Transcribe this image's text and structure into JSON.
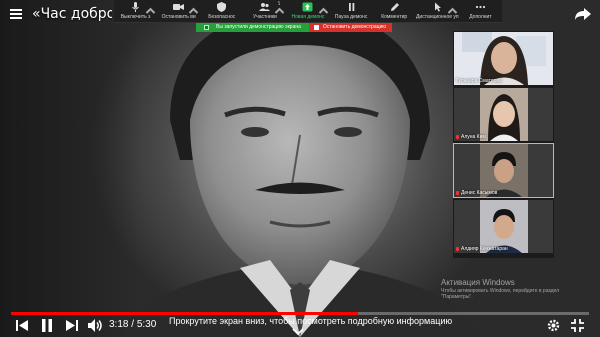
{
  "video": {
    "title": "«Час добропор",
    "current_time": "3:18",
    "separator": " / ",
    "duration": "5:30",
    "progress": 0.6,
    "hint": "Прокрутите экран вниз, чтобы посмотреть подробную информацию"
  },
  "zoom_toolbar": {
    "items": [
      {
        "label": "Выключить з",
        "icon": "microphone-icon"
      },
      {
        "label": "Остановить ви",
        "icon": "video-camera-icon"
      },
      {
        "label": "Безопаснос",
        "icon": "shield-icon"
      },
      {
        "label": "Участники",
        "icon": "participants-icon",
        "count": "5"
      },
      {
        "label": "Новая демонс",
        "icon": "share-screen-icon"
      },
      {
        "label": "Пауза демонс",
        "icon": "pause-icon"
      },
      {
        "label": "Комментир",
        "icon": "pencil-icon"
      },
      {
        "label": "Дистанционное уп",
        "icon": "remote-control-icon"
      },
      {
        "label": "Дополнит",
        "icon": "more-icon"
      }
    ]
  },
  "sharing_bar": {
    "status": "Вы запустили демонстрацию экрана",
    "stop_label": "Остановить демонстрацию"
  },
  "participants": [
    {
      "name": "Гульнара Сматлова",
      "muted": false
    },
    {
      "name": "Алуна Ким",
      "muted": true
    },
    {
      "name": "Денис Касымов",
      "muted": true
    },
    {
      "name": "Алдияр Кенжатаран",
      "muted": true
    }
  ],
  "watermark": {
    "line1": "Активация Windows",
    "line2": "Чтобы активировать Windows, перейдите в раздел \"Параметры\"."
  },
  "colors": {
    "accent_red": "#ff0000",
    "share_green": "#26a03a",
    "stop_red": "#d6312b"
  }
}
